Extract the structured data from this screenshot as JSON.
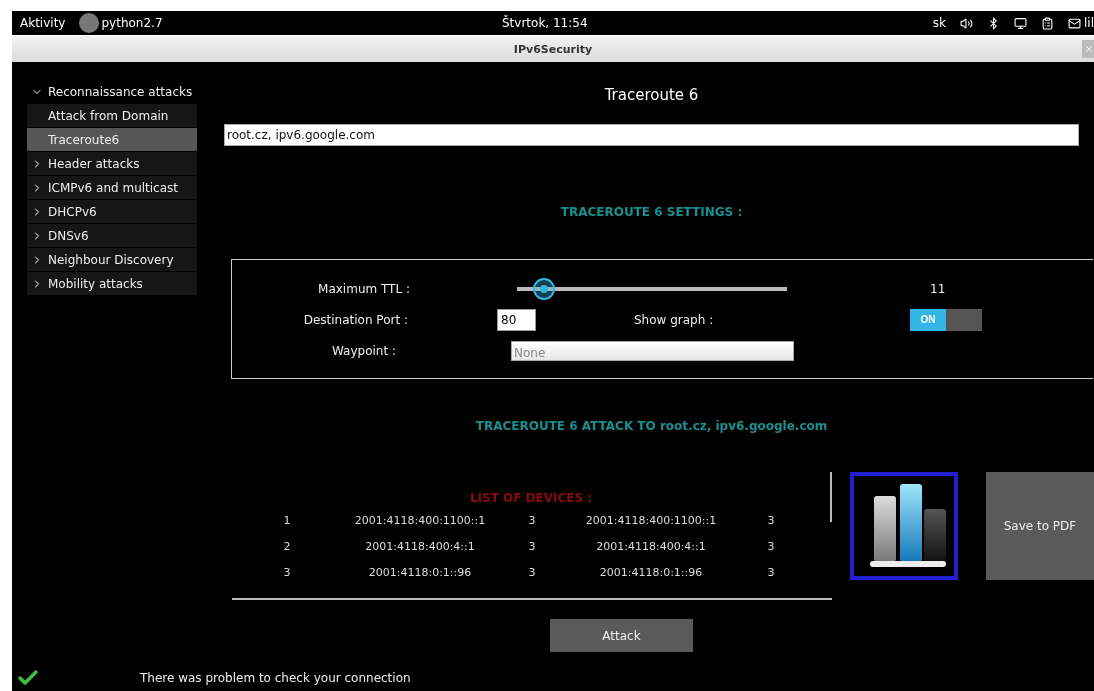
{
  "top_bar": {
    "activities": "Aktivity",
    "app": "python2.7",
    "clock": "Štvrtok, 11:54",
    "language": "sk",
    "user": "lil"
  },
  "window": {
    "title": "IPv6Security"
  },
  "sidebar": {
    "items": [
      {
        "label": "Reconnaissance attacks",
        "expanded": true,
        "selected": false,
        "children": [
          {
            "label": "Attack from Domain",
            "selected": false
          },
          {
            "label": "Traceroute6",
            "selected": true
          }
        ]
      },
      {
        "label": "Header attacks",
        "expanded": false,
        "selected": false
      },
      {
        "label": "ICMPv6 and multicast",
        "expanded": false,
        "selected": false
      },
      {
        "label": "DHCPv6",
        "expanded": false,
        "selected": false
      },
      {
        "label": "DNSv6",
        "expanded": false,
        "selected": false
      },
      {
        "label": "Neighbour Discovery",
        "expanded": false,
        "selected": false
      },
      {
        "label": "Mobility attacks",
        "expanded": false,
        "selected": false
      }
    ]
  },
  "page_title": "Traceroute 6",
  "targets_field": {
    "value": "root.cz, ipv6.google.com"
  },
  "settings_heading": "TRACEROUTE 6 SETTINGS :",
  "settings": {
    "max_ttl": {
      "label": "Maximum TTL :",
      "level": 0.1,
      "reading": "11"
    },
    "destination_port": {
      "label": "Destination Port :",
      "value": "80"
    },
    "show_graph": {
      "label": "Show graph :",
      "on": true,
      "on_label": "ON"
    },
    "waypoint": {
      "label": "Waypoint :",
      "placeholder": "None"
    }
  },
  "attack_heading": "TRACEROUTE 6 ATTACK TO root.cz, ipv6.google.com",
  "devices": {
    "heading": "LIST OF DEVICES :",
    "rows": [
      [
        "1",
        "2001:4118:400:1100::1",
        "3",
        "2001:4118:400:1100::1",
        "3"
      ],
      [
        "2",
        "2001:4118:400:4::1",
        "3",
        "2001:4118:400:4::1",
        "3"
      ],
      [
        "3",
        "2001:4118:0:1::96",
        "3",
        "2001:4118:0:1::96",
        "3"
      ]
    ]
  },
  "save_button": "Save to PDF",
  "attack_button": "Attack",
  "status": {
    "ok": true,
    "message": "There was problem to check your connection"
  }
}
